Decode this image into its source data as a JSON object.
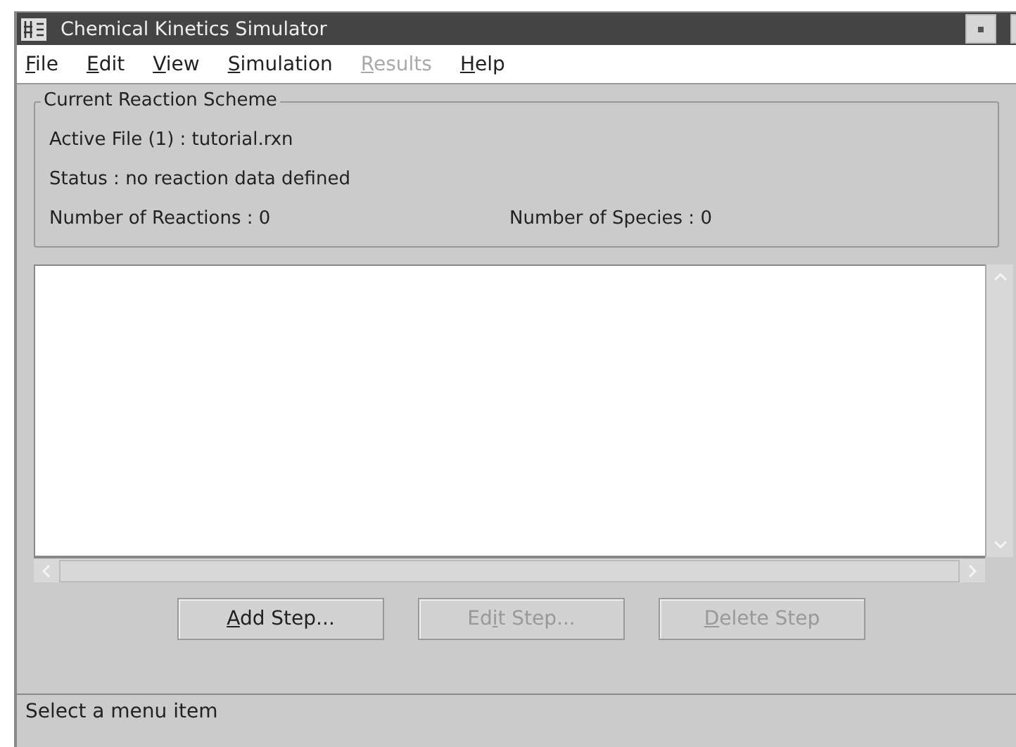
{
  "window": {
    "title": "Chemical Kinetics Simulator"
  },
  "menu": [
    {
      "key": "F",
      "after": "ile",
      "disabled": false
    },
    {
      "key": "E",
      "after": "dit",
      "disabled": false
    },
    {
      "key": "V",
      "after": "iew",
      "disabled": false
    },
    {
      "key": "S",
      "after": "imulation",
      "disabled": false
    },
    {
      "key": "R",
      "after": "esults",
      "disabled": true
    },
    {
      "key": "H",
      "after": "elp",
      "disabled": false
    }
  ],
  "scheme": {
    "title": "Current Reaction Scheme",
    "active_file": "Active File (1) : tutorial.rxn",
    "status": "Status : no reaction data defined",
    "reactions": "Number of Reactions : 0",
    "species": "Number of Species : 0"
  },
  "buttons": [
    {
      "key": "A",
      "after": "dd Step...",
      "disabled": false
    },
    {
      "before": "Ed",
      "key": "i",
      "after": "t Step...",
      "disabled": true
    },
    {
      "key": "D",
      "after": "elete Step",
      "disabled": true
    }
  ],
  "status_bar": "Select a menu item"
}
